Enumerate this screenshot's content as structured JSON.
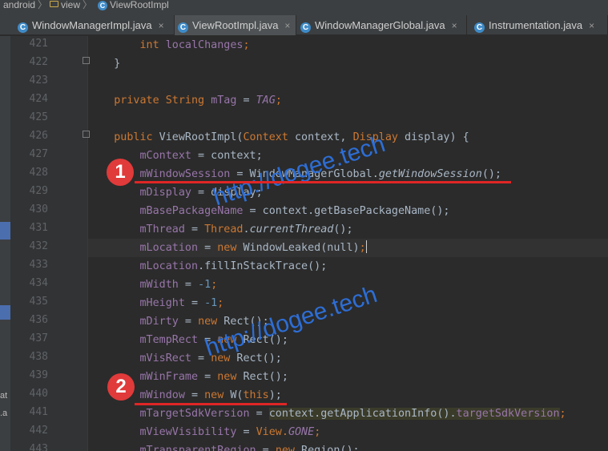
{
  "breadcrumb": [
    {
      "label": "android",
      "icon": "folder-icon"
    },
    {
      "label": "view",
      "icon": "folder-icon"
    },
    {
      "label": "ViewRootImpl",
      "icon": "class-icon"
    }
  ],
  "tabs": [
    {
      "label": "WindowManagerImpl.java",
      "active": false
    },
    {
      "label": "ViewRootImpl.java",
      "active": true
    },
    {
      "label": "WindowManagerGlobal.java",
      "active": false
    },
    {
      "label": "Instrumentation.java",
      "active": false
    }
  ],
  "tab_close_glyph": "×",
  "left_panel": {
    "item1": "at",
    "item2": ".a"
  },
  "line_numbers": [
    "421",
    "422",
    "423",
    "424",
    "425",
    "426",
    "427",
    "428",
    "429",
    "430",
    "431",
    "432",
    "433",
    "434",
    "435",
    "436",
    "437",
    "438",
    "439",
    "440",
    "441",
    "442",
    "443"
  ],
  "code": {
    "l421": {
      "kw": "int",
      "name": " localChanges",
      "semi": ";"
    },
    "l422": {
      "text": "}"
    },
    "l424": {
      "kw": "private",
      "type": " String ",
      "field": "mTag",
      "eq": " = ",
      "const": "TAG",
      "semi": ";"
    },
    "l426": {
      "kw": "public",
      "sig": " ViewRootImpl(",
      "type1": "Context",
      "p1": " context, ",
      "type2": "Display",
      "p2": " display) {"
    },
    "l427": {
      "field": "mContext",
      "rest": " = context;"
    },
    "l428": {
      "field": "mWindowSession",
      "mid": " = WindowManagerGlobal.",
      "call": "getWindowSession",
      "rest": "();"
    },
    "l429": {
      "field": "mDisplay",
      "rest": " = display;"
    },
    "l430": {
      "field": "mBasePackageName",
      "rest": " = context.getBasePackageName();"
    },
    "l431": {
      "field": "mThread",
      "eq": " = ",
      "type": "Thread",
      "dot": ".",
      "call": "currentThread",
      "rest": "();"
    },
    "l432": {
      "field": "mLocation",
      "eq": " = ",
      "kw": "new",
      "rest": " WindowLeaked(null)",
      "semi": ";"
    },
    "l433": {
      "field": "mLocation",
      "rest": ".fillInStackTrace();"
    },
    "l434": {
      "field": "mWidth",
      "eq": " = ",
      "num": "-1",
      "semi": ";"
    },
    "l435": {
      "field": "mHeight",
      "eq": " = ",
      "num": "-1",
      "semi": ";"
    },
    "l436": {
      "field": "mDirty",
      "eq": " = ",
      "kw": "new",
      "rest": " Rect();"
    },
    "l437": {
      "field": "mTempRect",
      "eq": " = ",
      "kw": "new",
      "rest": " Rect();"
    },
    "l438": {
      "field": "mVisRect",
      "eq": " = ",
      "kw": "new",
      "rest": " Rect();"
    },
    "l439": {
      "field": "mWinFrame",
      "eq": " = ",
      "kw": "new",
      "rest": " Rect();"
    },
    "l440": {
      "field": "mWindow",
      "eq": " = ",
      "kw": "new",
      "mid": " W(",
      "kw2": "this",
      "rest": ");"
    },
    "l441": {
      "field": "mTargetSdkVersion",
      "eq": " = ",
      "sel": "context.getApplicationInfo().",
      "field2": "targetSdkVersion",
      "semi": ";"
    },
    "l442": {
      "field": "mViewVisibility",
      "eq": " = ",
      "type": "View.",
      "const": "GONE",
      "semi": ";"
    },
    "l443": {
      "field": "mTransparentRegion",
      "eq": " = ",
      "kw": "new",
      "rest": " Region();"
    }
  },
  "annotations": {
    "badge1": "1",
    "badge2": "2",
    "watermark": "http://dogee.tech"
  },
  "colors": {
    "editor_bg": "#2b2b2b",
    "keyword": "#cc7832",
    "field": "#9876aa",
    "number": "#6897bb",
    "annotation_red": "#e03a3a",
    "watermark_blue": "#2d6ed6"
  }
}
